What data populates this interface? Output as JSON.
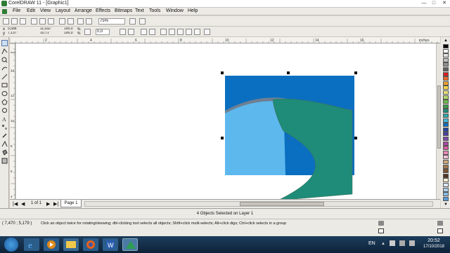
{
  "window": {
    "title": "CorelDRAW 11 - [Graphic1]",
    "controls": {
      "minimize": "—",
      "maximize": "□",
      "close": "✕"
    }
  },
  "menu": [
    "File",
    "Edit",
    "View",
    "Layout",
    "Arrange",
    "Effects",
    "Bitmaps",
    "Text",
    "Tools",
    "Window",
    "Help"
  ],
  "standard_toolbar": {
    "zoom": "75%"
  },
  "property_bar": {
    "x": "5,588 \"",
    "y": "7,137 \"",
    "width": "11,032 \"",
    "height": "10,71 \"",
    "scale_x": "100,0",
    "scale_y": "100,0",
    "scale_unit": "%",
    "rotation": "0,0"
  },
  "ruler": {
    "top_ticks": [
      "2",
      "4",
      "6",
      "8",
      "10",
      "12",
      "14",
      "16"
    ],
    "unit": "inches",
    "left_ticks": [
      "14",
      "12",
      "10",
      "8",
      "6",
      "4"
    ],
    "left_unit": "inches"
  },
  "page_nav": {
    "position": "1 of 1",
    "page_tab": "Page 1"
  },
  "status": {
    "selection": "4 Objects Selected on Layer 1",
    "coords": "( 7,470 ; 5,179 )",
    "hint": "Click an object twice for rotating/skewing; dbl-clicking tool selects all objects; Shift+click multi-selects; Alt+click digs; Ctrl+click selects in a group"
  },
  "taskbar": {
    "lang": "EN",
    "time": "20:52",
    "date": "17/10/2018"
  },
  "colors": {
    "blue_rect": "#0a6fc0",
    "light_blue": "#5db8ee",
    "teal": "#1e8c78",
    "gray_band": "#6e7f92",
    "palette": [
      "#000000",
      "#ffffff",
      "#e2e2e2",
      "#c0c0c0",
      "#909090",
      "#606060",
      "#d61f1f",
      "#e96a2a",
      "#f0a030",
      "#f6d54a",
      "#e9e07a",
      "#b7d96a",
      "#6dba4a",
      "#3b9b4b",
      "#1e8c78",
      "#2fa8a8",
      "#44b7d9",
      "#0a6fc0",
      "#2346a0",
      "#4a3fa0",
      "#7a4aa8",
      "#a84aa0",
      "#d35a9a",
      "#e88ab8",
      "#f3c2d8",
      "#c9a67a",
      "#a07a50",
      "#7a5230",
      "#4f3520",
      "#f5ead0",
      "#dde8f5",
      "#b0d0ec",
      "#8abce6",
      "#5a9ad8"
    ]
  }
}
